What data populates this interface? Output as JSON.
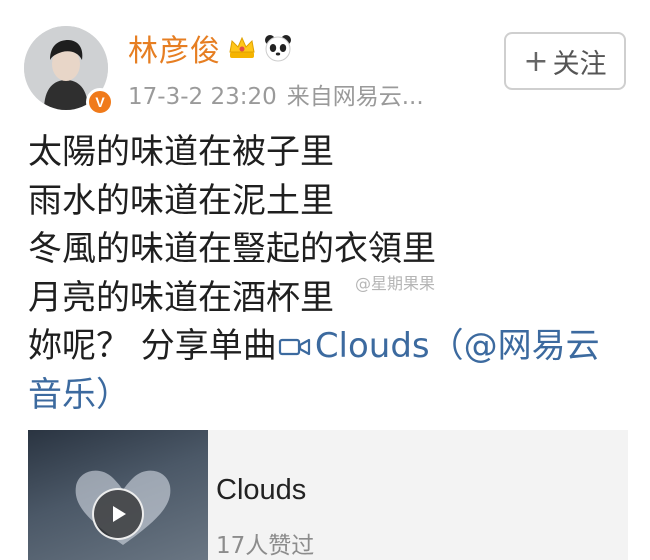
{
  "author": {
    "name": "林彦俊",
    "verified_badge": "V",
    "badges": [
      "crown-icon",
      "panda-icon"
    ]
  },
  "meta": {
    "timestamp": "17-3-2 23:20",
    "source": "来自网易云..."
  },
  "follow_button": {
    "plus": "+",
    "label": "关注"
  },
  "content": {
    "lines": [
      "太陽的味道在被子里",
      "雨水的味道在泥土里",
      "冬風的味道在豎起的衣領里",
      "月亮的味道在酒杯里"
    ],
    "last_line_prefix": "妳呢？ 分享单曲",
    "link_text": "Clouds（@网易云",
    "link_text_cont": "音乐）"
  },
  "music_card": {
    "title": "Clouds",
    "likes": "17人赞过"
  },
  "watermark": "@星期果果"
}
